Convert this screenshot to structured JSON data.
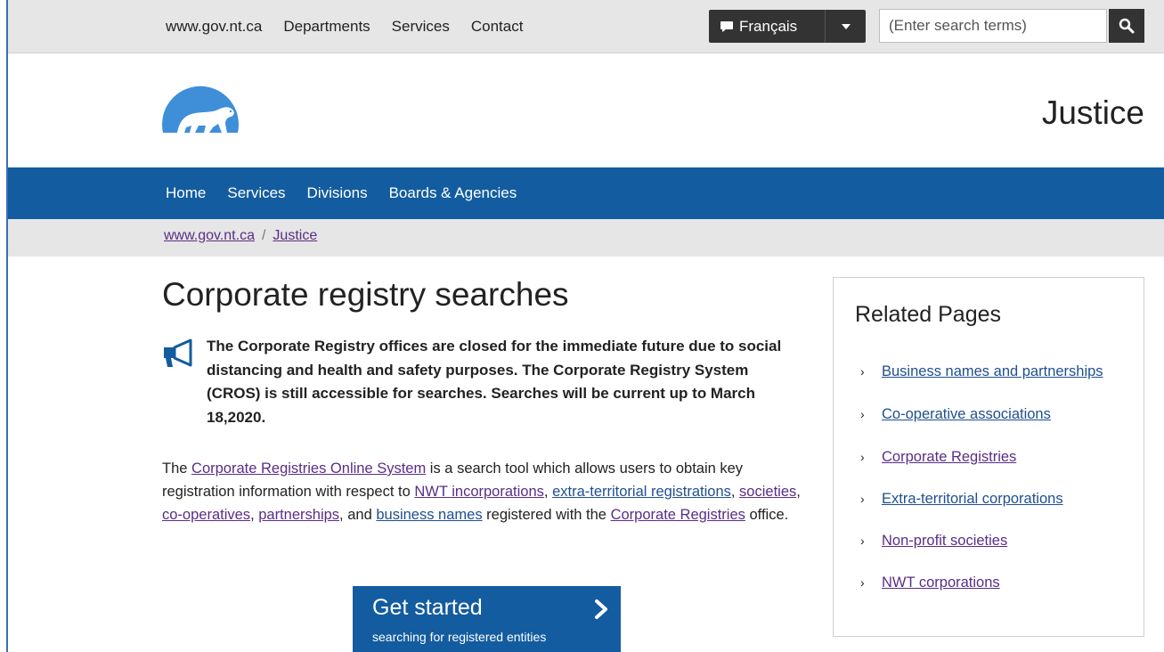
{
  "topbar": {
    "links": [
      "www.gov.nt.ca",
      "Departments",
      "Services",
      "Contact"
    ],
    "language_label": "Français",
    "search_placeholder": "(Enter search terms)"
  },
  "header": {
    "site_name": "Justice"
  },
  "mainnav": {
    "items": [
      "Home",
      "Services",
      "Divisions",
      "Boards & Agencies"
    ]
  },
  "breadcrumb": {
    "items": [
      "www.gov.nt.ca",
      "Justice"
    ],
    "separator": "/"
  },
  "main": {
    "title": "Corporate registry searches",
    "alert": "The Corporate Registry offices are closed for the immediate future due to social distancing and health and safety purposes. The Corporate Registry System (CROS) is still accessible for searches. Searches will be current up to March 18,2020.",
    "intro": {
      "t1": "The ",
      "link1": "Corporate Registries Online System",
      "t2": " is a search tool which allows users to obtain key registration information with respect to ",
      "link2": "NWT incorporations",
      "t3": ", ",
      "link3": "extra-territorial registrations",
      "t4": ", ",
      "link4": "societies",
      "t5": ", ",
      "link5": "co-operatives",
      "t6": ", ",
      "link6": "partnerships",
      "t7": ", and ",
      "link7": "business names",
      "t8": " registered with the ",
      "link8": "Corporate Registries",
      "t9": " office."
    },
    "cta": {
      "title": "Get started",
      "subtitle": "searching for registered entities"
    }
  },
  "sidebar": {
    "title": "Related Pages",
    "items": [
      "Business names and partnerships",
      "Co-operative associations",
      "Corporate Registries",
      "Extra-territorial corporations",
      "Non-profit societies",
      "NWT corporations"
    ]
  },
  "colors": {
    "nav_blue": "#135c9f",
    "dark_button": "#333333",
    "gray_bar": "#e6e6e6"
  },
  "icons": [
    "speech-bubble-icon",
    "caret-down-icon",
    "search-icon",
    "polar-bear-logo",
    "megaphone-icon",
    "chevron-right-icon"
  ]
}
